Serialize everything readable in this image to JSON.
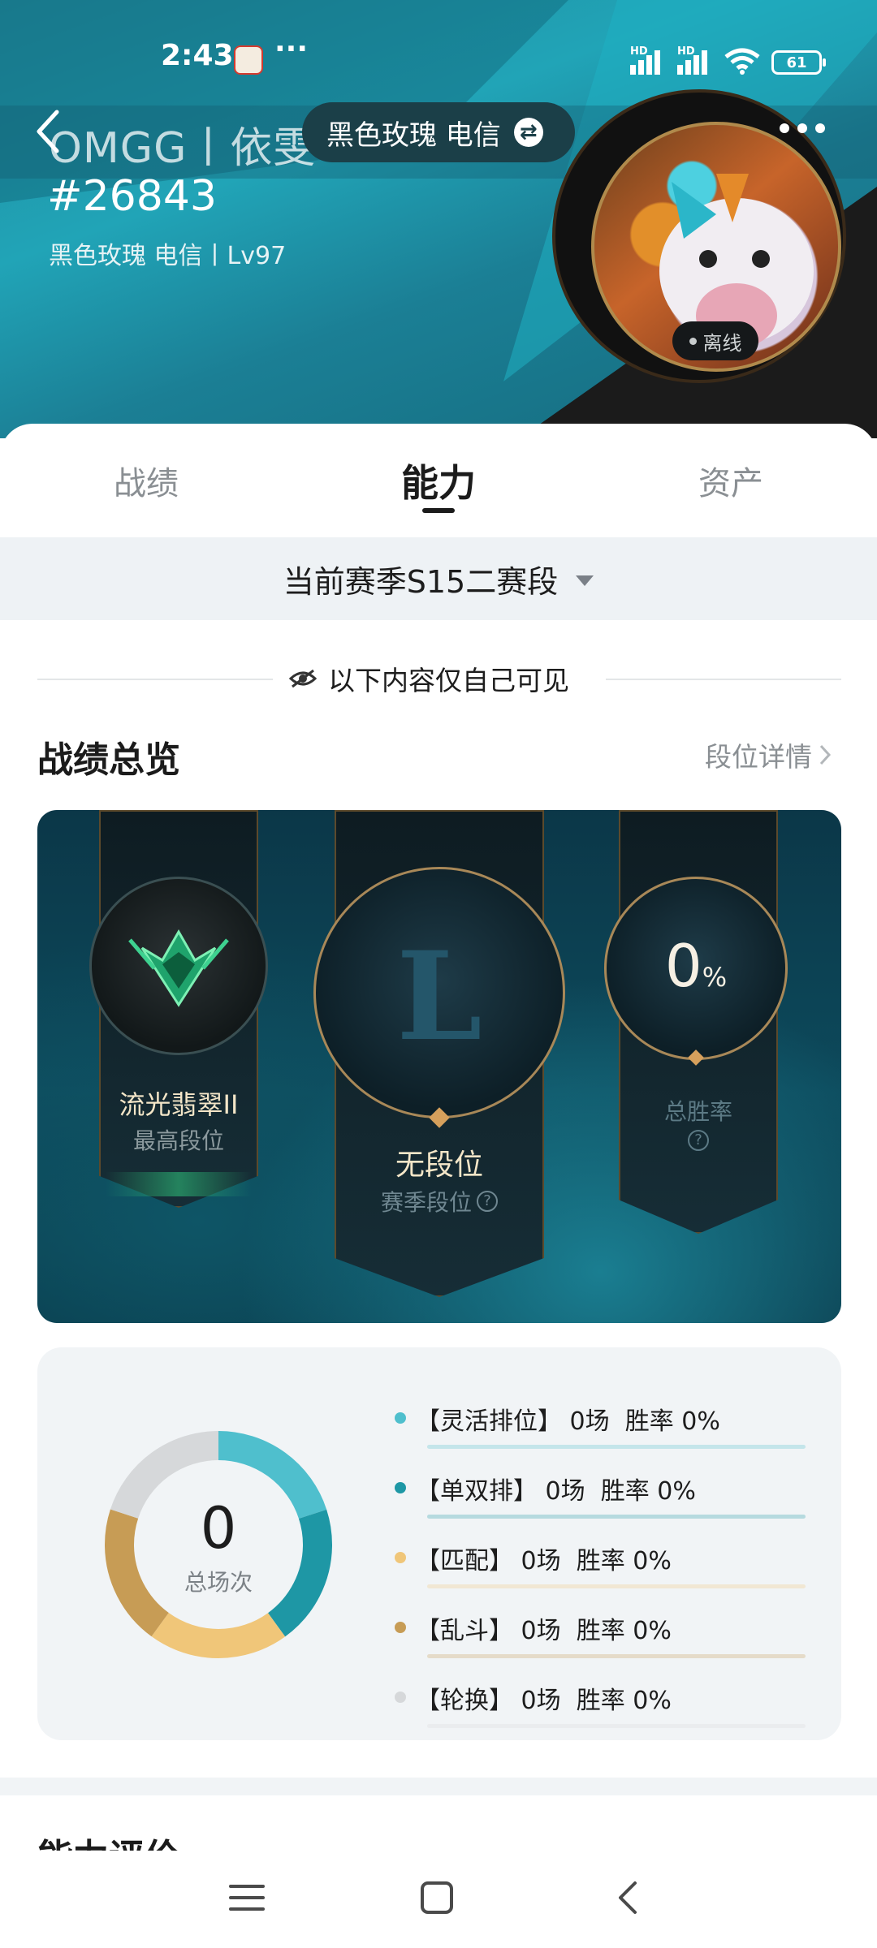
{
  "status_bar": {
    "time": "2:43",
    "dots": "···",
    "hd1": "HD",
    "hd2": "HD",
    "wifi_sub": "6",
    "battery": "61"
  },
  "profile": {
    "name": "OMGG丨依雯丶",
    "tag": "#26843",
    "server_level": "黑色玫瑰 电信丨Lv97",
    "server_selector": "黑色玫瑰 电信",
    "status": "离线"
  },
  "tabs": [
    {
      "label": "战绩",
      "active": false
    },
    {
      "label": "能力",
      "active": true
    },
    {
      "label": "资产",
      "active": false
    }
  ],
  "season_filter": "当前赛季S15二赛段",
  "privacy_note": "以下内容仅自己可见",
  "overview": {
    "title": "战绩总览",
    "link": "段位详情",
    "highest_rank": {
      "value": "流光翡翠II",
      "label": "最高段位"
    },
    "season_rank": {
      "value": "无段位",
      "label": "赛季段位",
      "emblem": "L"
    },
    "win_rate": {
      "value": "0",
      "unit": "%",
      "label": "总胜率"
    }
  },
  "stats": {
    "total_value": "0",
    "total_label": "总场次",
    "queues": [
      {
        "name": "【灵活排位】",
        "games": "0场",
        "winrate": "胜率 0%",
        "color": "#4fbfcd"
      },
      {
        "name": "【单双排】",
        "games": "0场",
        "winrate": "胜率 0%",
        "color": "#1e97a5"
      },
      {
        "name": "【匹配】",
        "games": "0场",
        "winrate": "胜率 0%",
        "color": "#f0c679"
      },
      {
        "name": "【乱斗】",
        "games": "0场",
        "winrate": "胜率 0%",
        "color": "#c79c55"
      },
      {
        "name": "【轮换】",
        "games": "0场",
        "winrate": "胜率 0%",
        "color": "#d6d8da"
      }
    ]
  },
  "next_section_title": "能力评价",
  "colors": {
    "accent_dark": "#1b1b1b",
    "muted": "#8a8f93"
  }
}
